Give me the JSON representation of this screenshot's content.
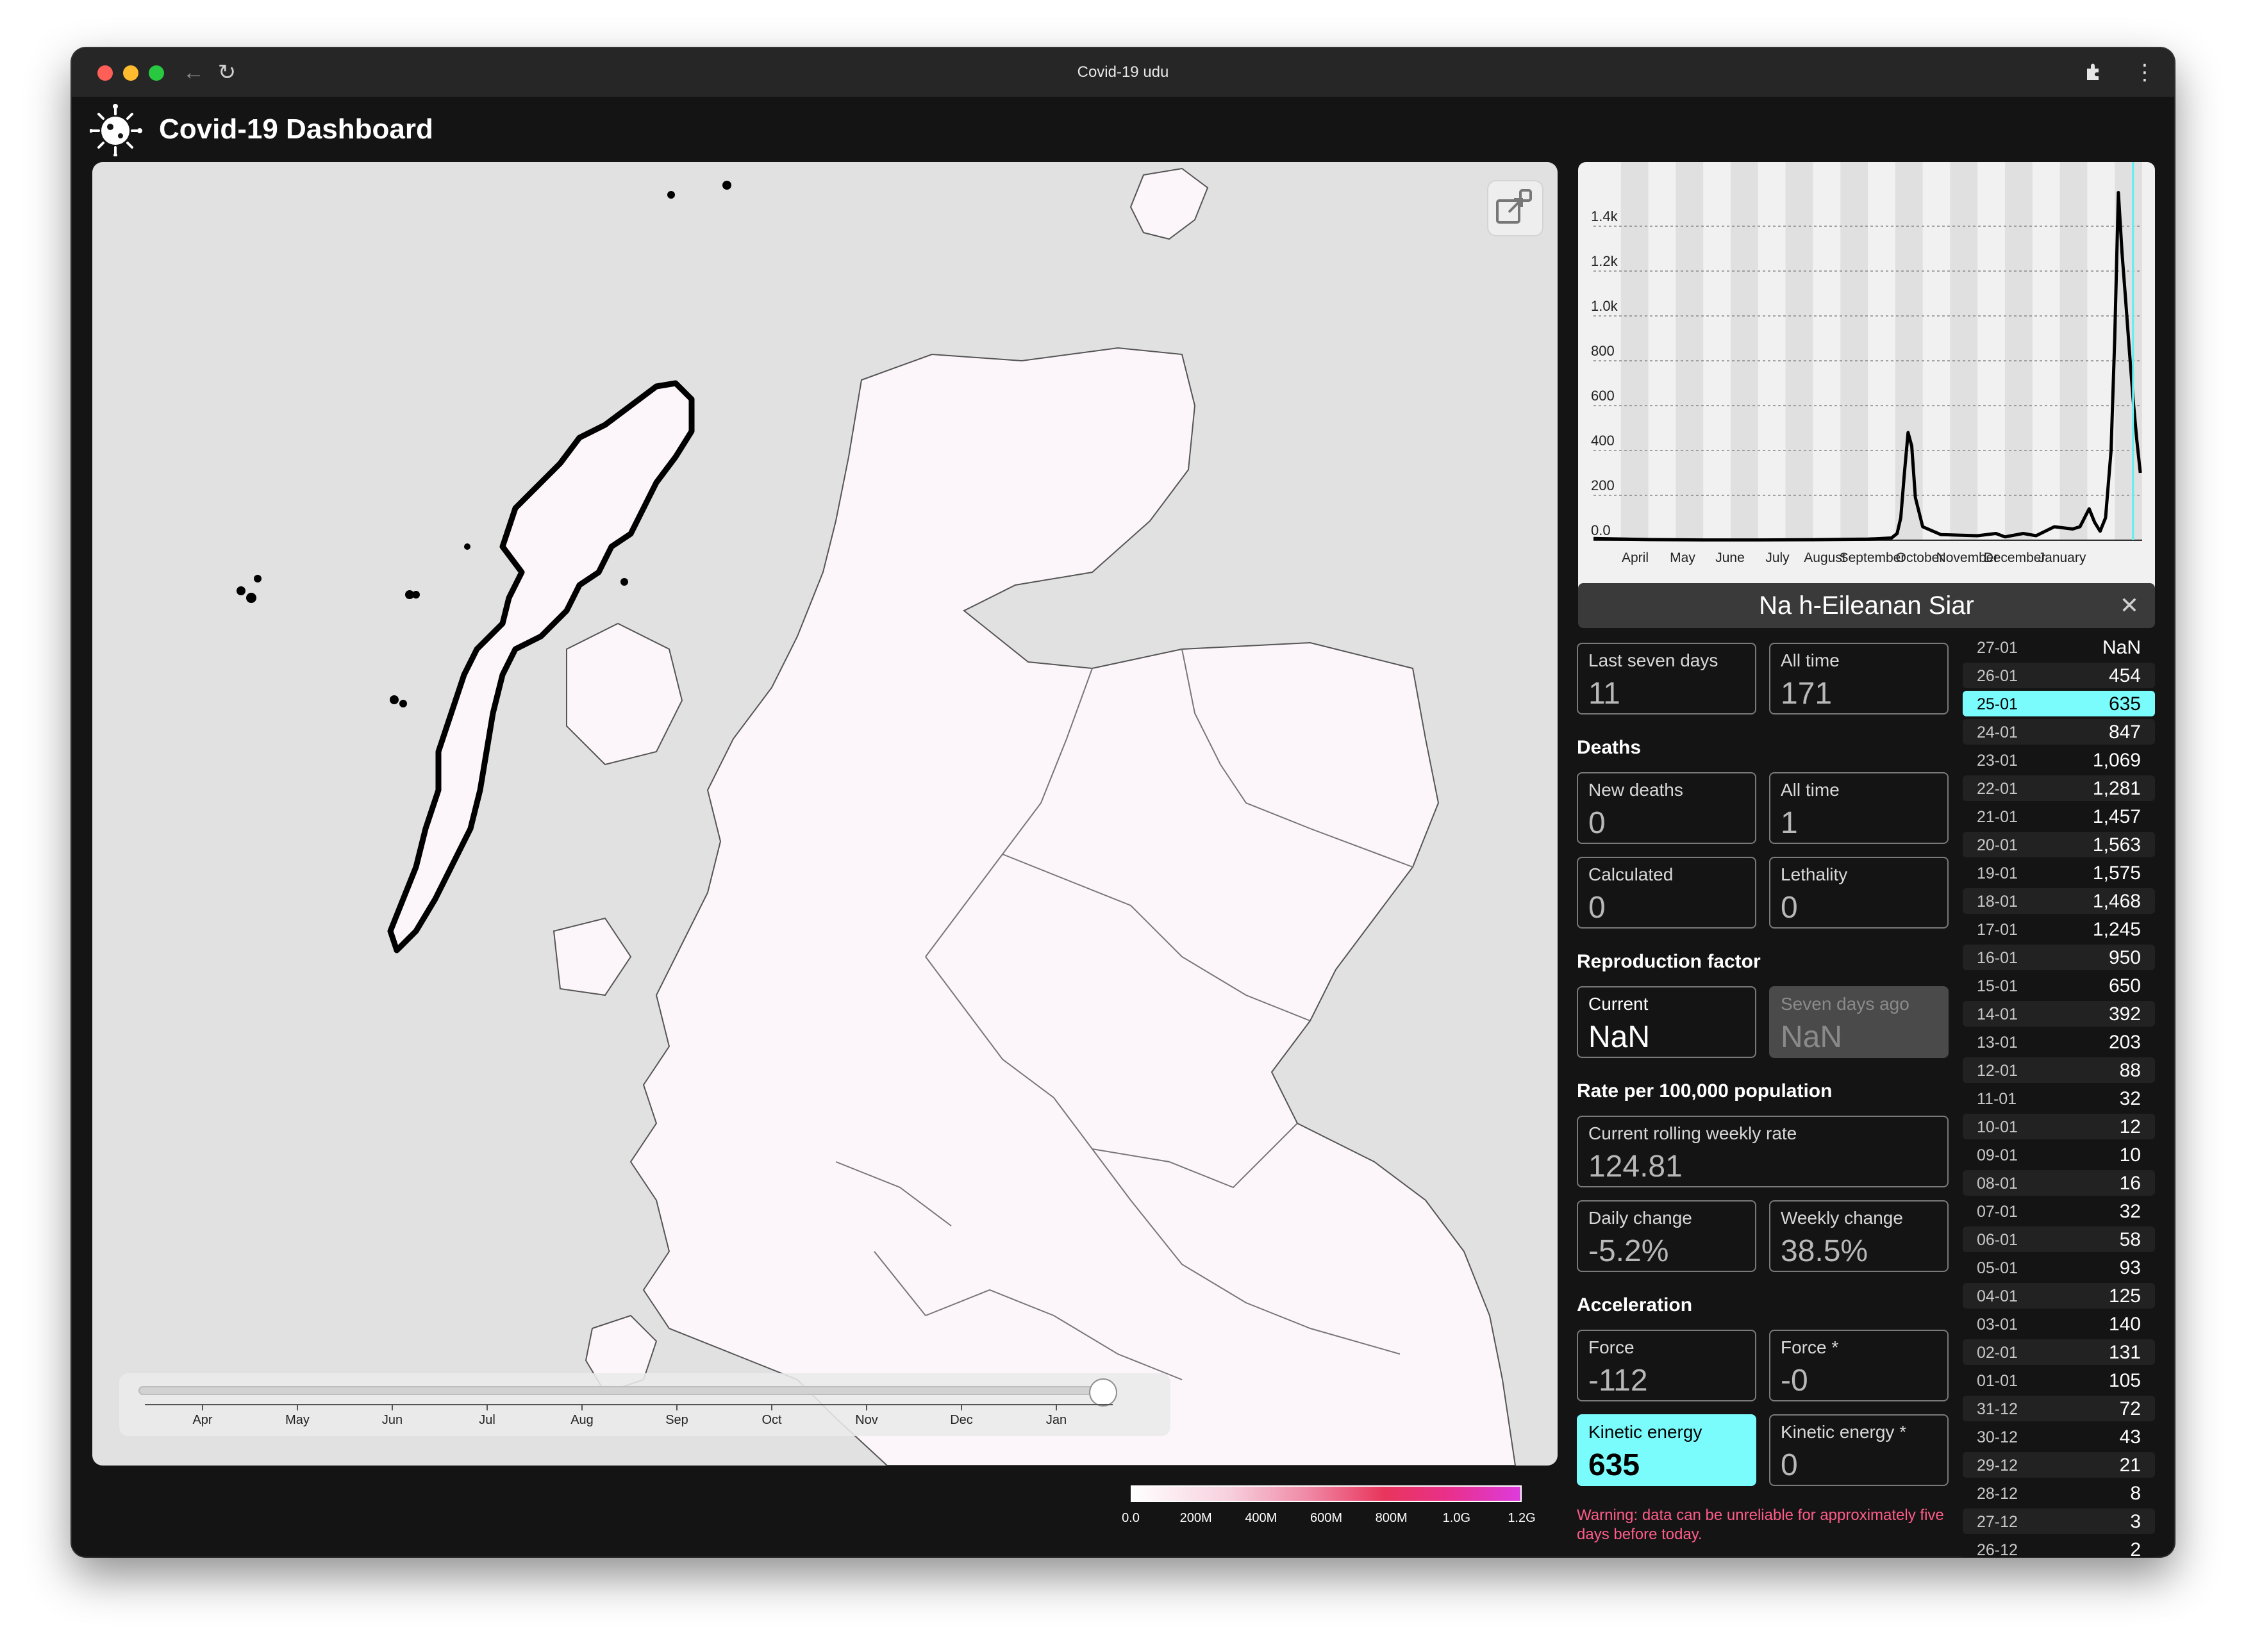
{
  "window": {
    "title": "Covid-19 udu"
  },
  "header": {
    "title": "Covid-19 Dashboard"
  },
  "map": {
    "timeline_months": [
      "Apr",
      "May",
      "Jun",
      "Jul",
      "Aug",
      "Sep",
      "Oct",
      "Nov",
      "Dec",
      "Jan"
    ],
    "timeline_position": 0.99,
    "legend_labels": [
      "0.0",
      "200M",
      "400M",
      "600M",
      "800M",
      "1.0G",
      "1.2G"
    ]
  },
  "chart_data": {
    "type": "line",
    "x_labels": [
      "April",
      "May",
      "June",
      "July",
      "August",
      "September",
      "October",
      "November",
      "December",
      "January"
    ],
    "y_ticks": [
      "0.0",
      "200",
      "400",
      "600",
      "800",
      "1.0k",
      "1.2k",
      "1.4k"
    ],
    "ylim": [
      0,
      1600
    ],
    "x_range": [
      0,
      300
    ],
    "series": [
      {
        "x": [
          0,
          30,
          60,
          90,
          120,
          150,
          163,
          166,
          168,
          170,
          172,
          174,
          176,
          180,
          190,
          210,
          220,
          225,
          235,
          242,
          252,
          262,
          266,
          271,
          274,
          277,
          280,
          283,
          285,
          287,
          289,
          291,
          293,
          295,
          297,
          299
        ],
        "y": [
          8,
          3,
          1,
          1,
          2,
          5,
          10,
          30,
          100,
          300,
          480,
          420,
          190,
          60,
          25,
          20,
          30,
          15,
          30,
          20,
          60,
          50,
          60,
          140,
          80,
          40,
          100,
          400,
          900,
          1550,
          1281,
          1069,
          847,
          635,
          454,
          300
        ]
      }
    ]
  },
  "area": {
    "name": "Na h-Eileanan Siar",
    "last_seven_days": {
      "label": "Last seven days",
      "value": "11"
    },
    "all_time_cases": {
      "label": "All time",
      "value": "171"
    },
    "deaths": {
      "title": "Deaths",
      "new_deaths": {
        "label": "New deaths",
        "value": "0"
      },
      "all_time": {
        "label": "All time",
        "value": "1"
      },
      "calculated": {
        "label": "Calculated",
        "value": "0"
      },
      "lethality": {
        "label": "Lethality",
        "value": "0"
      }
    },
    "reproduction": {
      "title": "Reproduction factor",
      "current": {
        "label": "Current",
        "value": "NaN"
      },
      "seven_days_ago": {
        "label": "Seven days ago",
        "value": "NaN"
      }
    },
    "rate": {
      "title": "Rate per 100,000 population",
      "rolling": {
        "label": "Current rolling weekly rate",
        "value": "124.81"
      },
      "daily_change": {
        "label": "Daily change",
        "value": "-5.2%"
      },
      "weekly_change": {
        "label": "Weekly change",
        "value": "38.5%"
      }
    },
    "acceleration": {
      "title": "Acceleration",
      "force": {
        "label": "Force",
        "value": "-112"
      },
      "force_star": {
        "label": "Force *",
        "value": "-0"
      },
      "kinetic": {
        "label": "Kinetic energy",
        "value": "635"
      },
      "kinetic_star": {
        "label": "Kinetic energy *",
        "value": "0"
      }
    },
    "warning": "Warning: data can be unreliable for approximately five days before today."
  },
  "daily": [
    {
      "date": "27-01",
      "value": "NaN"
    },
    {
      "date": "26-01",
      "value": "454"
    },
    {
      "date": "25-01",
      "value": "635",
      "selected": true
    },
    {
      "date": "24-01",
      "value": "847"
    },
    {
      "date": "23-01",
      "value": "1,069"
    },
    {
      "date": "22-01",
      "value": "1,281"
    },
    {
      "date": "21-01",
      "value": "1,457"
    },
    {
      "date": "20-01",
      "value": "1,563"
    },
    {
      "date": "19-01",
      "value": "1,575"
    },
    {
      "date": "18-01",
      "value": "1,468"
    },
    {
      "date": "17-01",
      "value": "1,245"
    },
    {
      "date": "16-01",
      "value": "950"
    },
    {
      "date": "15-01",
      "value": "650"
    },
    {
      "date": "14-01",
      "value": "392"
    },
    {
      "date": "13-01",
      "value": "203"
    },
    {
      "date": "12-01",
      "value": "88"
    },
    {
      "date": "11-01",
      "value": "32"
    },
    {
      "date": "10-01",
      "value": "12"
    },
    {
      "date": "09-01",
      "value": "10"
    },
    {
      "date": "08-01",
      "value": "16"
    },
    {
      "date": "07-01",
      "value": "32"
    },
    {
      "date": "06-01",
      "value": "58"
    },
    {
      "date": "05-01",
      "value": "93"
    },
    {
      "date": "04-01",
      "value": "125"
    },
    {
      "date": "03-01",
      "value": "140"
    },
    {
      "date": "02-01",
      "value": "131"
    },
    {
      "date": "01-01",
      "value": "105"
    },
    {
      "date": "31-12",
      "value": "72"
    },
    {
      "date": "30-12",
      "value": "43"
    },
    {
      "date": "29-12",
      "value": "21"
    },
    {
      "date": "28-12",
      "value": "8"
    },
    {
      "date": "27-12",
      "value": "3"
    },
    {
      "date": "26-12",
      "value": "2"
    }
  ]
}
